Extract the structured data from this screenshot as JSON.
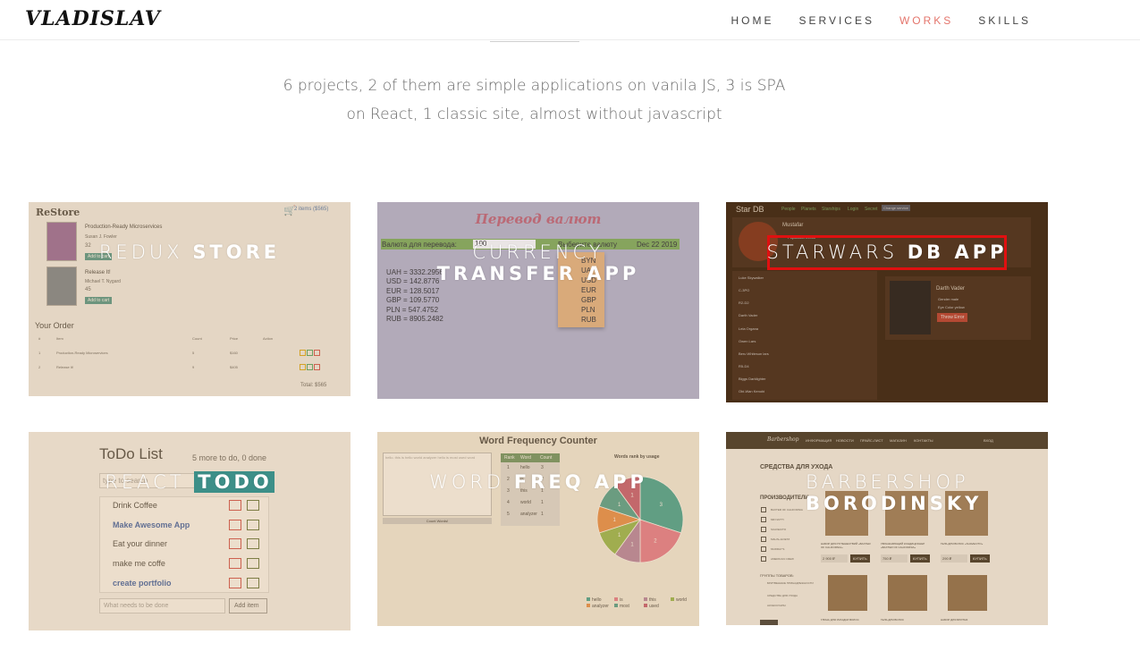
{
  "header": {
    "logo": "VLADISLAV",
    "nav": [
      {
        "label": "HOME",
        "active": false
      },
      {
        "label": "SERVICES",
        "active": false
      },
      {
        "label": "WORKS",
        "active": true
      },
      {
        "label": "SKILLS",
        "active": false
      }
    ]
  },
  "intro": {
    "line1": "6 projects, 2 of them are simple applications on vanila JS, 3 is SPA",
    "line2": "on React, 1 classic site, almost without javascript"
  },
  "cards": {
    "store": {
      "title_thin": "REDUX ",
      "title_bold": "STORE",
      "app_name": "ReStore",
      "cart": "2 items ($565)",
      "book1_title": "Production-Ready Microservices",
      "book1_author": "Susan J. Fowler",
      "book1_price": "32",
      "book2_title": "Release It!",
      "book2_author": "Michael T. Nygard",
      "book2_price": "45",
      "add_label": "Add to cart",
      "order_heading": "Your Order",
      "col_num": "#",
      "col_item": "Item",
      "col_count": "Count",
      "col_price": "Price",
      "col_action": "Action",
      "row1": {
        "n": "1",
        "item": "Production-Ready Microservices",
        "count": "5",
        "price": "$160"
      },
      "row2": {
        "n": "2",
        "item": "Release It!",
        "count": "9",
        "price": "$405"
      },
      "total": "Total: $565"
    },
    "currency": {
      "title_thin": "CURRENCY",
      "title_bold": "TRANSFER APP",
      "heading": "Перевод валют",
      "label": "Валюта для перевода:",
      "input_value": "100",
      "choose": "Выберите валюту",
      "date": "Dec 22 2019",
      "rates": [
        "UAH = 3332.2956",
        "USD = 142.8776",
        "EUR = 128.5017",
        "GBP = 109.5770",
        "PLN = 547.4752",
        "RUB = 8905.2482"
      ],
      "options": [
        "BYN",
        "UAH",
        "USD",
        "EUR",
        "GBP",
        "PLN",
        "RUB"
      ]
    },
    "starwars": {
      "title_thin": "STARWARS ",
      "title_bold": "DB APP",
      "app_name": "Star DB",
      "tabs": [
        "People",
        "Planets",
        "Starships",
        "Login",
        "Secret"
      ],
      "change_service": "Change service",
      "planet": "Mustafar",
      "planet_population": "Population  20000",
      "people": [
        "Luke Skywalker",
        "C-3PO",
        "R2-D2",
        "Darth Vader",
        "Leia Organa",
        "Owen Lars",
        "Beru Whitesun lars",
        "R5-D4",
        "Biggs Darklighter",
        "Obi-Wan Kenobi"
      ],
      "person": "Darth Vader",
      "gender": "Gender  male",
      "eye_color": "Eye Color  yellow",
      "throw_error": "Throw Error"
    },
    "todo": {
      "title_thin": "REACT ",
      "title_bold": "TODO",
      "heading": "ToDo List",
      "counter": "5 more to do, 0 done",
      "search_placeholder": "type to search",
      "items": [
        "Drink Coffee",
        "Make Awesome App",
        "Eat your dinner",
        "make me coffe",
        "create portfolio"
      ],
      "add_placeholder": "What needs to be done",
      "add_label": "Add item"
    },
    "wordfreq": {
      "title_thin": "WORD ",
      "title_bold": "FREQ APP",
      "heading": "Word Frequency Counter",
      "textarea_text": "hello. this is hello world analyzer hello is most used word",
      "count_button": "Count Words!",
      "table_headers": [
        "Rank",
        "Word",
        "Count"
      ],
      "table_rows": [
        [
          "1",
          "hello",
          "3"
        ],
        [
          "2",
          "is",
          "2"
        ],
        [
          "3",
          "this",
          "1"
        ],
        [
          "4",
          "world",
          "1"
        ],
        [
          "5",
          "analyzer",
          "1"
        ]
      ],
      "chart_title": "Words rank by usage",
      "pie_labels": [
        "3",
        "2",
        "1",
        "1",
        "1",
        "1",
        "1"
      ],
      "legend": [
        "hello",
        "is",
        "this",
        "world",
        "analyzer",
        "most",
        "used"
      ]
    },
    "barber": {
      "title_thin": "BARBERSHOP",
      "title_bold": "BORODINSKY",
      "brand": "Barbershop",
      "nav": [
        "ИНФОРМАЦИЯ",
        "НОВОСТИ",
        "ПРАЙС-ЛИСТ",
        "МАГАЗИН",
        "КОНТАКТЫ"
      ],
      "login": "ВХОД",
      "heading": "СРЕДСТВА ДЛЯ УХОДА",
      "producers": "ПРОИЗВОДИТЕЛИ:",
      "filters": [
        "BAXTER OF CALIFORNIA",
        "MR NATTY",
        "SUAVECITO",
        "MALIN+GOETZ",
        "MURRAY'S",
        "AMERICAN CREW"
      ],
      "groups": "ГРУППЫ ТОВАРОВ:",
      "group_items": [
        "БРИТВЕННЫЕ ПРИНАДЛЕЖНОСТИ",
        "СРЕДСТВА ДЛЯ УХОДА",
        "АКСЕССУАРЫ"
      ],
      "products": [
        {
          "name": "НАБОР ДЛЯ ПУТЕШЕСТВИЙ «BAXTER OF CALIFORNIA»",
          "price": "2 900 ₽"
        },
        {
          "name": "УВЛАЖНЯЮЩИЙ КОНДИЦИОНЕР «BAXTER OF CALIFORNIA»",
          "price": "750 ₽"
        },
        {
          "name": "ГЕЛЬ ДЛЯ ВОЛОС «SUAVECITO»",
          "price": "290 ₽"
        }
      ],
      "buy": "КУПИТЬ",
      "bottom_products": [
        "ГЛИНА ДЛЯ УКЛАДКИ ВОЛОС",
        "ГЕЛЬ ДЛЯ ВОЛОС",
        "НАБОР ДЛЯ БРИТЬЯ"
      ]
    }
  }
}
